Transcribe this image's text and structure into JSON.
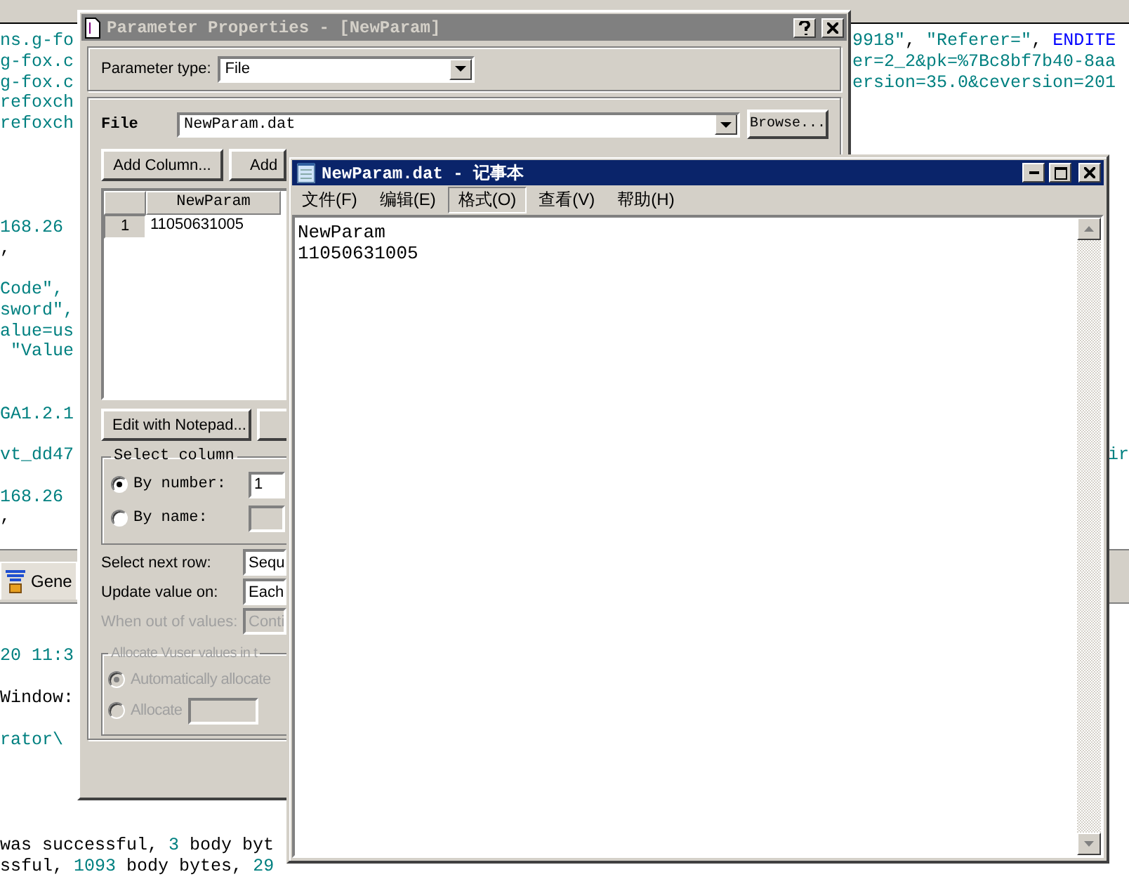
{
  "editor": {
    "lines": [
      {
        "left": [
          {
            "text": "ns.g-fo",
            "kind": "string"
          }
        ],
        "right": [
          {
            "text": "9918\"",
            "kind": "string"
          },
          {
            "text": ", ",
            "kind": "plain"
          },
          {
            "text": "\"Referer=\"",
            "kind": "string"
          },
          {
            "text": ", ",
            "kind": "plain"
          },
          {
            "text": "ENDITE",
            "kind": "keyword"
          }
        ]
      },
      {
        "left": [
          {
            "text": "g-fox.c",
            "kind": "string"
          }
        ],
        "right": [
          {
            "text": "er=2_2&pk=%7Bc8bf7b40-8aa",
            "kind": "string"
          }
        ]
      },
      {
        "left": [
          {
            "text": "g-fox.c",
            "kind": "string"
          }
        ],
        "right": [
          {
            "text": "ersion=35.0&ceversion=201",
            "kind": "string"
          }
        ]
      },
      {
        "left": [
          {
            "text": "refoxch",
            "kind": "string"
          }
        ]
      },
      {
        "left": [
          {
            "text": "refoxch",
            "kind": "string"
          }
        ]
      },
      {
        "left": [
          {
            "text": "168.26",
            "kind": "string"
          }
        ]
      },
      {
        "left": [
          {
            "text": ",",
            "kind": "plain"
          }
        ]
      },
      {
        "left": [
          {
            "text": "Code\",",
            "kind": "string"
          }
        ]
      },
      {
        "left": [
          {
            "text": "sword\",",
            "kind": "string"
          }
        ]
      },
      {
        "left": [
          {
            "text": "alue=us",
            "kind": "string"
          }
        ]
      },
      {
        "left": [
          {
            "text": " \"Value",
            "kind": "string"
          }
        ]
      },
      {
        "left": [
          {
            "text": "GA1.2.1",
            "kind": "string"
          }
        ]
      },
      {
        "left": [
          {
            "text": "vt_dd47",
            "kind": "string"
          }
        ],
        "right_edge": [
          {
            "text": "ir",
            "kind": "string"
          }
        ]
      },
      {
        "left": [
          {
            "text": "168.26",
            "kind": "string"
          }
        ]
      },
      {
        "left": [
          {
            "text": ",",
            "kind": "plain"
          }
        ]
      }
    ]
  },
  "bottom_panel": {
    "tab": {
      "label": "Gene",
      "selected": true
    },
    "lines": [
      {
        "segments": [
          {
            "text": "20 11:3",
            "kind": "string"
          }
        ]
      },
      {
        "segments": [
          {
            "text": "Window:",
            "kind": "plain"
          }
        ]
      },
      {
        "segments": [
          {
            "text": "rator\\",
            "kind": "string"
          }
        ]
      },
      {
        "segments": [
          {
            "text": "was successful, ",
            "kind": "plain"
          },
          {
            "text": "3",
            "kind": "string"
          },
          {
            "text": " body byt",
            "kind": "plain"
          }
        ]
      },
      {
        "segments": [
          {
            "text": "ssful, ",
            "kind": "plain"
          },
          {
            "text": "1093",
            "kind": "string"
          },
          {
            "text": " body bytes, ",
            "kind": "plain"
          },
          {
            "text": "29",
            "kind": "string"
          }
        ]
      }
    ]
  },
  "parameter_dialog": {
    "title": "Parameter Properties - [NewParam]",
    "parameter_type": {
      "label": "Parameter type:",
      "value": "File"
    },
    "file": {
      "label": "File",
      "value": "NewParam.dat",
      "browse": "Browse..."
    },
    "table_buttons": [
      "Add Column...",
      "Add"
    ],
    "table": {
      "columns": [
        "NewParam"
      ],
      "rows": [
        {
          "number": "1",
          "cells": [
            "11050631005"
          ]
        }
      ]
    },
    "edit_buttons": [
      "Edit with Notepad..."
    ],
    "select_column": {
      "legend": "Select column",
      "options": [
        {
          "label": "By number:",
          "selected": true,
          "value": "1"
        },
        {
          "label": "By name:",
          "selected": false
        }
      ]
    },
    "settings": [
      {
        "label": "Select next row:",
        "value": "Sequ",
        "disabled": false
      },
      {
        "label": "Update value on:",
        "value": "Each",
        "disabled": false
      },
      {
        "label": "When out of values:",
        "value": "Conti",
        "disabled": true
      }
    ],
    "allocate": {
      "legend": "Allocate Vuser values in t",
      "disabled": true,
      "options": [
        {
          "label": "Automatically allocate",
          "selected": true,
          "has_field": false
        },
        {
          "label": "Allocate",
          "selected": false,
          "has_field": true
        }
      ]
    }
  },
  "notepad": {
    "title": "NewParam.dat - 记事本",
    "menu": [
      {
        "label": "文件(F)",
        "selected": false
      },
      {
        "label": "编辑(E)",
        "selected": false
      },
      {
        "label": "格式(O)",
        "selected": true
      },
      {
        "label": "查看(V)",
        "selected": false
      },
      {
        "label": "帮助(H)",
        "selected": false
      }
    ],
    "lines": [
      "NewParam",
      "11050631005"
    ]
  }
}
